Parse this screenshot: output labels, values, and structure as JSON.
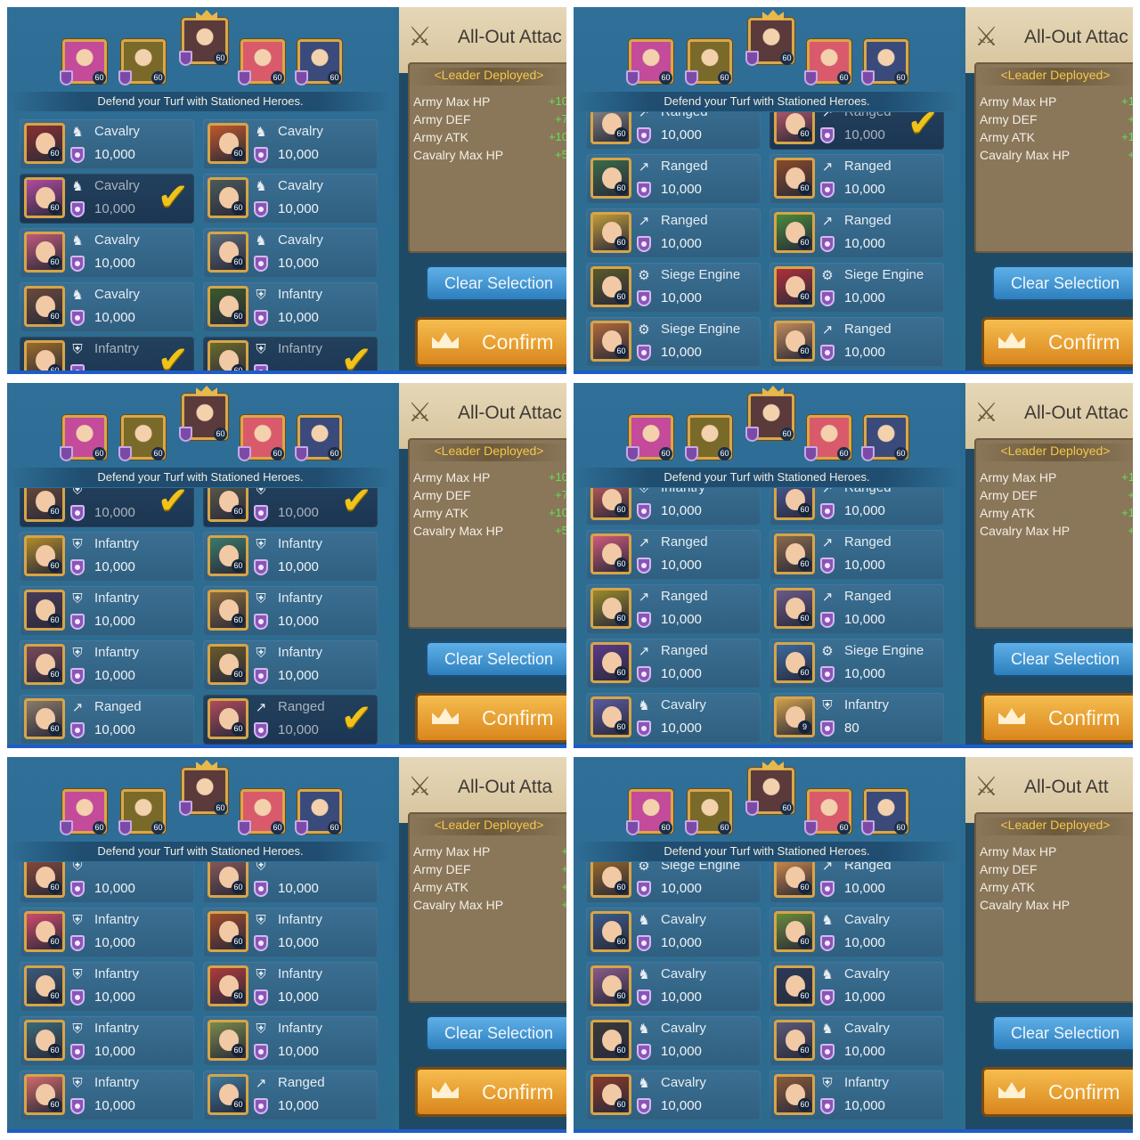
{
  "defend_text": "Defend your Turf with Stationed Heroes.",
  "right": {
    "title": "All-Out Attac",
    "leader": "<Leader Deployed>",
    "stats": [
      "Army Max HP",
      "Army DEF",
      "Army ATK",
      "Cavalry Max HP"
    ],
    "clear": "Clear Selection",
    "confirm": "Confirm"
  },
  "heroes_top": [
    {
      "level": "60",
      "color": "#c44a9a"
    },
    {
      "level": "60",
      "color": "#7a6a2a"
    },
    {
      "level": "60",
      "color": "#5a3a3a"
    },
    {
      "level": "60",
      "color": "#d95a6a"
    },
    {
      "level": "60",
      "color": "#3a4a7a"
    }
  ],
  "panels": [
    {
      "right_title": "All-Out Attac",
      "stat_values": [
        "+10",
        "+7",
        "+10",
        "+5"
      ],
      "cards": [
        {
          "type": "Cavalry",
          "amount": "10,000",
          "icon": "horse-icon",
          "level": "60",
          "selected": false,
          "check": false,
          "color": "#8a3030"
        },
        {
          "type": "Cavalry",
          "amount": "10,000",
          "icon": "horse-icon",
          "level": "60",
          "selected": false,
          "check": false,
          "color": "#c0582a"
        },
        {
          "type": "Cavalry",
          "amount": "10,000",
          "icon": "horse-icon",
          "level": "60",
          "selected": true,
          "check": true,
          "color": "#b24aa0"
        },
        {
          "type": "Cavalry",
          "amount": "10,000",
          "icon": "horse-icon",
          "level": "60",
          "selected": false,
          "check": false,
          "color": "#4a5a5a"
        },
        {
          "type": "Cavalry",
          "amount": "10,000",
          "icon": "horse-icon",
          "level": "60",
          "selected": false,
          "check": false,
          "color": "#c05a7a"
        },
        {
          "type": "Cavalry",
          "amount": "10,000",
          "icon": "horse-icon",
          "level": "60",
          "selected": false,
          "check": false,
          "color": "#5a6a7a"
        },
        {
          "type": "Cavalry",
          "amount": "10,000",
          "icon": "horse-icon",
          "level": "60",
          "selected": false,
          "check": false,
          "color": "#6a4a3a"
        },
        {
          "type": "Infantry",
          "amount": "10,000",
          "icon": "shield-icon",
          "level": "60",
          "selected": false,
          "check": false,
          "color": "#3a5a2a"
        },
        {
          "type": "Infantry",
          "amount": "",
          "icon": "shield-icon",
          "level": "60",
          "selected": true,
          "check": true,
          "color": "#9a6a2a"
        },
        {
          "type": "Infantry",
          "amount": "",
          "icon": "shield-icon",
          "level": "60",
          "selected": true,
          "check": true,
          "color": "#6a6a2a"
        }
      ]
    },
    {
      "right_title": "All-Out Attac",
      "stat_values": [
        "+1",
        "+",
        "+1",
        "+"
      ],
      "cards": [
        {
          "type": "Ranged",
          "amount": "10,000",
          "icon": "bow-icon",
          "level": "60",
          "selected": false,
          "check": false,
          "color": "#8a8a8a",
          "partial": true
        },
        {
          "type": "Ranged",
          "amount": "10,000",
          "icon": "bow-icon",
          "level": "60",
          "selected": true,
          "check": true,
          "color": "#c05a6a",
          "partial": true
        },
        {
          "type": "Ranged",
          "amount": "10,000",
          "icon": "bow-icon",
          "level": "60",
          "selected": false,
          "check": false,
          "color": "#3a6a4a"
        },
        {
          "type": "Ranged",
          "amount": "10,000",
          "icon": "bow-icon",
          "level": "60",
          "selected": false,
          "check": false,
          "color": "#8a4a2a"
        },
        {
          "type": "Ranged",
          "amount": "10,000",
          "icon": "bow-icon",
          "level": "60",
          "selected": false,
          "check": false,
          "color": "#c09a3a"
        },
        {
          "type": "Ranged",
          "amount": "10,000",
          "icon": "bow-icon",
          "level": "60",
          "selected": false,
          "check": false,
          "color": "#4a8a3a"
        },
        {
          "type": "Siege Engine",
          "amount": "10,000",
          "icon": "siege-icon",
          "level": "60",
          "selected": false,
          "check": false,
          "color": "#5a5a2a"
        },
        {
          "type": "Siege Engine",
          "amount": "10,000",
          "icon": "siege-icon",
          "level": "60",
          "selected": false,
          "check": false,
          "color": "#b0303a"
        },
        {
          "type": "Siege Engine",
          "amount": "10,000",
          "icon": "siege-icon",
          "level": "60",
          "selected": false,
          "check": false,
          "color": "#b06a3a"
        },
        {
          "type": "Ranged",
          "amount": "10,000",
          "icon": "bow-icon",
          "level": "60",
          "selected": false,
          "check": false,
          "color": "#c08a5a"
        }
      ]
    },
    {
      "right_title": "All-Out Attac",
      "stat_values": [
        "+10",
        "+7",
        "+10",
        "+5"
      ],
      "cards": [
        {
          "type": "",
          "amount": "10,000",
          "icon": "shield-icon",
          "level": "60",
          "selected": true,
          "check": true,
          "color": "#6a4a3a",
          "partial": true
        },
        {
          "type": "",
          "amount": "10,000",
          "icon": "shield-icon",
          "level": "60",
          "selected": true,
          "check": true,
          "color": "#5a5a4a",
          "partial": true
        },
        {
          "type": "Infantry",
          "amount": "10,000",
          "icon": "shield-icon",
          "level": "60",
          "selected": false,
          "check": false,
          "color": "#b08a2a"
        },
        {
          "type": "Infantry",
          "amount": "10,000",
          "icon": "shield-icon",
          "level": "60",
          "selected": false,
          "check": false,
          "color": "#3a7a6a"
        },
        {
          "type": "Infantry",
          "amount": "10,000",
          "icon": "shield-icon",
          "level": "60",
          "selected": false,
          "check": false,
          "color": "#4a3a5a"
        },
        {
          "type": "Infantry",
          "amount": "10,000",
          "icon": "shield-icon",
          "level": "60",
          "selected": false,
          "check": false,
          "color": "#8a6a3a"
        },
        {
          "type": "Infantry",
          "amount": "10,000",
          "icon": "shield-icon",
          "level": "60",
          "selected": false,
          "check": false,
          "color": "#7a4a5a"
        },
        {
          "type": "Infantry",
          "amount": "10,000",
          "icon": "shield-icon",
          "level": "60",
          "selected": false,
          "check": false,
          "color": "#6a5a2a"
        },
        {
          "type": "Ranged",
          "amount": "10,000",
          "icon": "bow-icon",
          "level": "60",
          "selected": false,
          "check": false,
          "color": "#8a7a6a"
        },
        {
          "type": "Ranged",
          "amount": "10,000",
          "icon": "bow-icon",
          "level": "60",
          "selected": true,
          "check": true,
          "color": "#b04a5a"
        }
      ]
    },
    {
      "right_title": "All-Out Attac",
      "stat_values": [
        "+1",
        "+",
        "+1",
        "+"
      ],
      "cards": [
        {
          "type": "Infantry",
          "amount": "10,000",
          "icon": "shield-icon",
          "level": "60",
          "selected": false,
          "check": false,
          "color": "#c05a5a",
          "partial": true
        },
        {
          "type": "Ranged",
          "amount": "10,000",
          "icon": "bow-icon",
          "level": "60",
          "selected": false,
          "check": false,
          "color": "#4a5a9a",
          "partial": true
        },
        {
          "type": "Ranged",
          "amount": "10,000",
          "icon": "bow-icon",
          "level": "60",
          "selected": false,
          "check": false,
          "color": "#d05a7a"
        },
        {
          "type": "Ranged",
          "amount": "10,000",
          "icon": "bow-icon",
          "level": "60",
          "selected": false,
          "check": false,
          "color": "#8a6a4a"
        },
        {
          "type": "Ranged",
          "amount": "10,000",
          "icon": "bow-icon",
          "level": "60",
          "selected": false,
          "check": false,
          "color": "#9a8a2a"
        },
        {
          "type": "Ranged",
          "amount": "10,000",
          "icon": "bow-icon",
          "level": "60",
          "selected": false,
          "check": false,
          "color": "#6a5a8a"
        },
        {
          "type": "Ranged",
          "amount": "10,000",
          "icon": "bow-icon",
          "level": "60",
          "selected": false,
          "check": false,
          "color": "#5a3a8a"
        },
        {
          "type": "Siege Engine",
          "amount": "10,000",
          "icon": "siege-icon",
          "level": "60",
          "selected": false,
          "check": false,
          "color": "#3a6aa0"
        },
        {
          "type": "Cavalry",
          "amount": "10,000",
          "icon": "horse-icon",
          "level": "60",
          "selected": false,
          "check": false,
          "color": "#5a5aa0"
        },
        {
          "type": "Infantry",
          "amount": "80",
          "icon": "shield-icon",
          "level": "9",
          "selected": false,
          "check": false,
          "color": "#d0a04a"
        }
      ]
    },
    {
      "right_title": "All-Out Atta",
      "stat_values": [
        "+",
        "+",
        "+",
        "+"
      ],
      "cards": [
        {
          "type": "",
          "amount": "10,000",
          "icon": "shield-icon",
          "level": "60",
          "selected": false,
          "check": false,
          "color": "#8a4a3a",
          "partial": true
        },
        {
          "type": "",
          "amount": "10,000",
          "icon": "shield-icon",
          "level": "60",
          "selected": false,
          "check": false,
          "color": "#8a5a5a",
          "partial": true
        },
        {
          "type": "Infantry",
          "amount": "10,000",
          "icon": "shield-icon",
          "level": "60",
          "selected": false,
          "check": false,
          "color": "#d04a6a"
        },
        {
          "type": "Infantry",
          "amount": "10,000",
          "icon": "shield-icon",
          "level": "60",
          "selected": false,
          "check": false,
          "color": "#a04a2a"
        },
        {
          "type": "Infantry",
          "amount": "10,000",
          "icon": "shield-icon",
          "level": "60",
          "selected": false,
          "check": false,
          "color": "#3a5a7a"
        },
        {
          "type": "Infantry",
          "amount": "10,000",
          "icon": "shield-icon",
          "level": "60",
          "selected": false,
          "check": false,
          "color": "#b03a3a"
        },
        {
          "type": "Infantry",
          "amount": "10,000",
          "icon": "shield-icon",
          "level": "60",
          "selected": false,
          "check": false,
          "color": "#3a6a7a"
        },
        {
          "type": "Infantry",
          "amount": "10,000",
          "icon": "shield-icon",
          "level": "60",
          "selected": false,
          "check": false,
          "color": "#7a8a4a"
        },
        {
          "type": "Infantry",
          "amount": "10,000",
          "icon": "shield-icon",
          "level": "60",
          "selected": false,
          "check": false,
          "color": "#d06a6a"
        },
        {
          "type": "Ranged",
          "amount": "10,000",
          "icon": "bow-icon",
          "level": "60",
          "selected": false,
          "check": false,
          "color": "#3a7aa0"
        }
      ]
    },
    {
      "right_title": "All-Out Att",
      "stat_values": [
        "",
        "",
        "",
        ""
      ],
      "cards": [
        {
          "type": "Siege Engine",
          "amount": "10,000",
          "icon": "siege-icon",
          "level": "60",
          "selected": false,
          "check": false,
          "color": "#9a6a2a",
          "partial": true
        },
        {
          "type": "Ranged",
          "amount": "10,000",
          "icon": "bow-icon",
          "level": "60",
          "selected": false,
          "check": false,
          "color": "#d08a4a",
          "partial": true
        },
        {
          "type": "Cavalry",
          "amount": "10,000",
          "icon": "horse-icon",
          "level": "60",
          "selected": false,
          "check": false,
          "color": "#3a5a8a"
        },
        {
          "type": "Cavalry",
          "amount": "10,000",
          "icon": "horse-icon",
          "level": "60",
          "selected": false,
          "check": false,
          "color": "#6a8a3a"
        },
        {
          "type": "Cavalry",
          "amount": "10,000",
          "icon": "horse-icon",
          "level": "60",
          "selected": false,
          "check": false,
          "color": "#8a5a8a"
        },
        {
          "type": "Cavalry",
          "amount": "10,000",
          "icon": "horse-icon",
          "level": "60",
          "selected": false,
          "check": false,
          "color": "#2a3a5a"
        },
        {
          "type": "Cavalry",
          "amount": "10,000",
          "icon": "horse-icon",
          "level": "60",
          "selected": false,
          "check": false,
          "color": "#3a3a3a"
        },
        {
          "type": "Cavalry",
          "amount": "10,000",
          "icon": "horse-icon",
          "level": "60",
          "selected": false,
          "check": false,
          "color": "#5a5a7a"
        },
        {
          "type": "Cavalry",
          "amount": "10,000",
          "icon": "horse-icon",
          "level": "60",
          "selected": false,
          "check": false,
          "color": "#8a3a2a"
        },
        {
          "type": "Infantry",
          "amount": "10,000",
          "icon": "shield-icon",
          "level": "60",
          "selected": false,
          "check": false,
          "color": "#8a5a3a"
        }
      ]
    }
  ]
}
